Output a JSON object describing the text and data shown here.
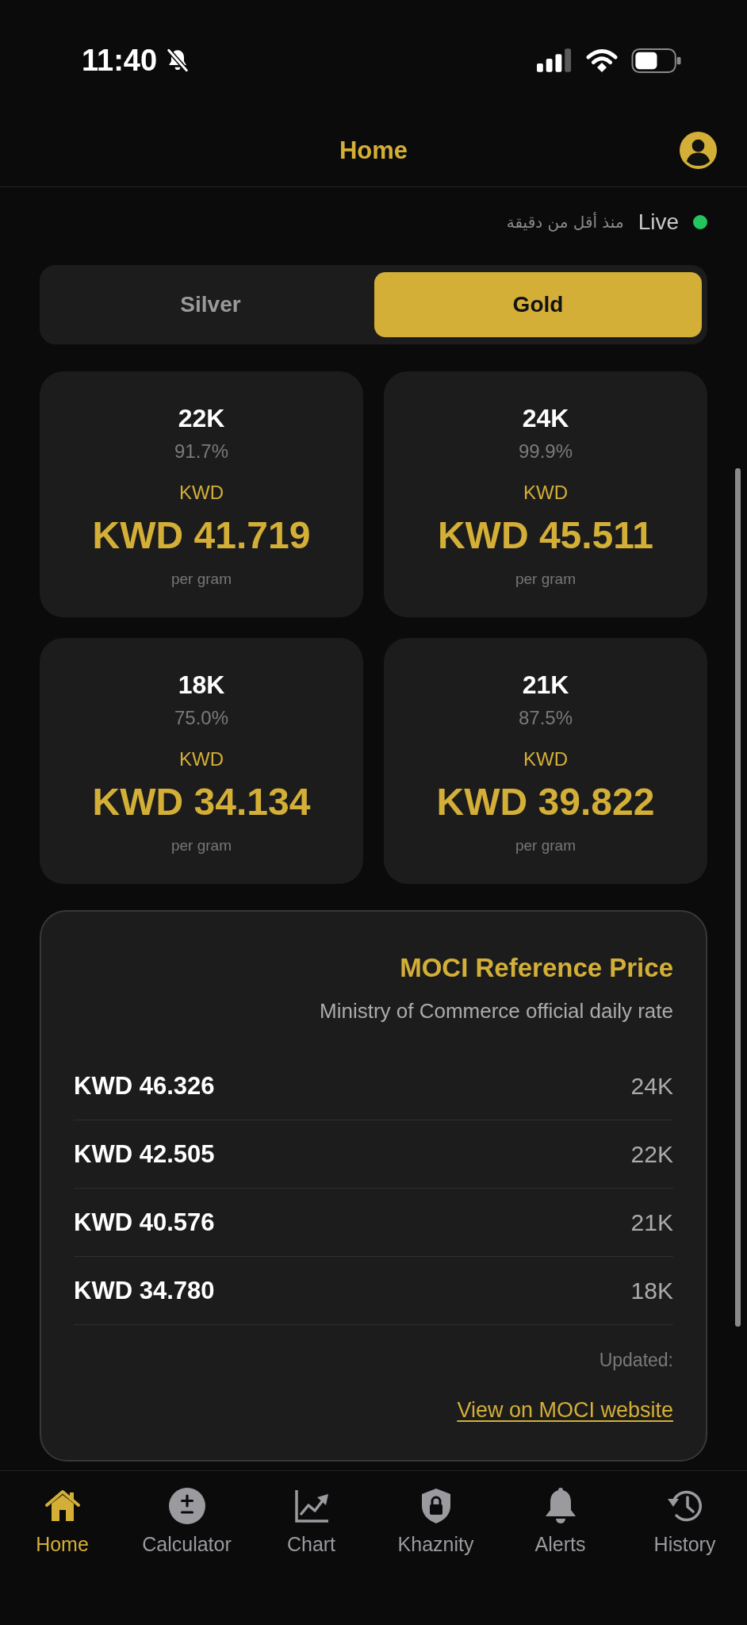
{
  "status_bar": {
    "time": "11:40"
  },
  "header": {
    "title": "Home"
  },
  "live_status": {
    "updated": "منذ أقل من دقيقة",
    "label": "Live"
  },
  "metal_tabs": [
    {
      "label": "Silver",
      "selected": false
    },
    {
      "label": "Gold",
      "selected": true
    }
  ],
  "karat_cards": [
    {
      "karat": "22K",
      "purity": "91.7%",
      "currency": "KWD",
      "price": "KWD 41.719",
      "unit": "per gram"
    },
    {
      "karat": "24K",
      "purity": "99.9%",
      "currency": "KWD",
      "price": "KWD 45.511",
      "unit": "per gram"
    },
    {
      "karat": "18K",
      "purity": "75.0%",
      "currency": "KWD",
      "price": "KWD 34.134",
      "unit": "per gram"
    },
    {
      "karat": "21K",
      "purity": "87.5%",
      "currency": "KWD",
      "price": "KWD 39.822",
      "unit": "per gram"
    }
  ],
  "moci": {
    "title": "MOCI Reference Price",
    "subtitle": "Ministry of Commerce official daily rate",
    "rows": [
      {
        "price": "KWD 46.326",
        "karat": "24K"
      },
      {
        "price": "KWD 42.505",
        "karat": "22K"
      },
      {
        "price": "KWD 40.576",
        "karat": "21K"
      },
      {
        "price": "KWD 34.780",
        "karat": "18K"
      }
    ],
    "updated": "Updated:",
    "link": "View on MOCI website"
  },
  "tab_bar": [
    {
      "label": "Home",
      "kind": "home",
      "selected": true
    },
    {
      "label": "Calculator",
      "kind": "calculator",
      "selected": false
    },
    {
      "label": "Chart",
      "kind": "chart",
      "selected": false
    },
    {
      "label": "Khaznity",
      "kind": "vault",
      "selected": false
    },
    {
      "label": "Alerts",
      "kind": "alerts",
      "selected": false
    },
    {
      "label": "History",
      "kind": "history",
      "selected": false
    }
  ]
}
